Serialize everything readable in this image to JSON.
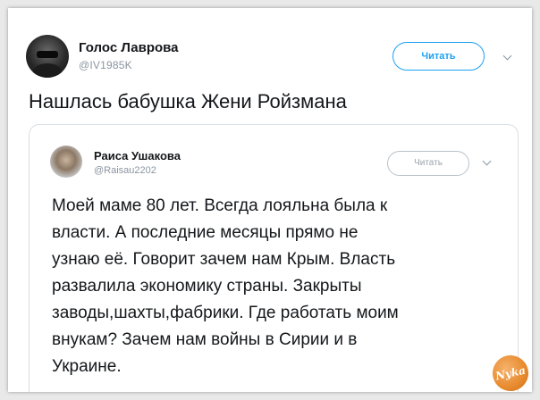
{
  "tweet": {
    "author_name": "Голос Лаврова",
    "author_handle": "@IV1985K",
    "follow_label": "Читать",
    "text": "Нашлась бабушка Жени Ройзмана"
  },
  "quoted_tweet": {
    "author_name": "Раиса Ушакова",
    "author_handle": "@Raisau2202",
    "follow_label": "Читать",
    "lines": [
      "Моей маме 80 лет. Всегда лояльна была к",
      "власти. А последние месяцы прямо не",
      "узнаю её. Говорит зачем нам Крым. Власть",
      "развалила экономику страны. Закрыты",
      "заводы,шахты,фабрики. Где работать моим",
      "внукам? Зачем нам войны в Сирии и в",
      "Украине."
    ]
  },
  "watermark": {
    "text": "Nyka"
  },
  "icons": {
    "main_avatar": "user-avatar-icon",
    "quote_avatar": "user-avatar-icon",
    "menu": "chevron-down-icon"
  },
  "colors": {
    "accent": "#1da1f2",
    "text": "#14171a",
    "muted": "#8a95a0",
    "watermark": "#e88a2e"
  }
}
